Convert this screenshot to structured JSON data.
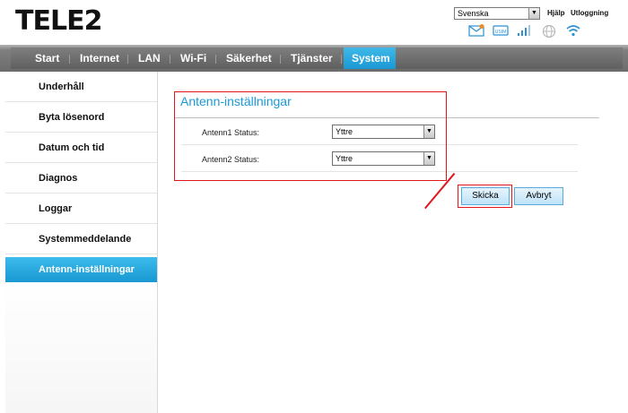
{
  "header": {
    "logo_text": "TELE2",
    "language": "Svenska",
    "help_link": "Hjälp",
    "logout_link": "Utloggning",
    "icons": [
      "sms-icon",
      "sim-icon",
      "signal-icon",
      "globe-icon",
      "wifi-icon"
    ]
  },
  "nav": {
    "items": [
      {
        "label": "Start"
      },
      {
        "label": "Internet"
      },
      {
        "label": "LAN"
      },
      {
        "label": "Wi-Fi"
      },
      {
        "label": "Säkerhet"
      },
      {
        "label": "Tjänster"
      },
      {
        "label": "System"
      }
    ],
    "active": "System"
  },
  "sidebar": {
    "items": [
      {
        "label": "Underhåll"
      },
      {
        "label": "Byta lösenord"
      },
      {
        "label": "Datum och tid"
      },
      {
        "label": "Diagnos"
      },
      {
        "label": "Loggar"
      },
      {
        "label": "Systemmeddelande"
      },
      {
        "label": "Antenn-inställningar"
      }
    ],
    "active": "Antenn-inställningar"
  },
  "content": {
    "title": "Antenn-inställningar",
    "fields": [
      {
        "label": "Antenn1 Status:",
        "value": "Yttre"
      },
      {
        "label": "Antenn2 Status:",
        "value": "Yttre"
      }
    ],
    "submit_label": "Skicka",
    "cancel_label": "Avbryt"
  },
  "colors": {
    "accent": "#1a9ad6",
    "highlight": "#e0171f",
    "nav_bg": "#6b6b6b"
  }
}
